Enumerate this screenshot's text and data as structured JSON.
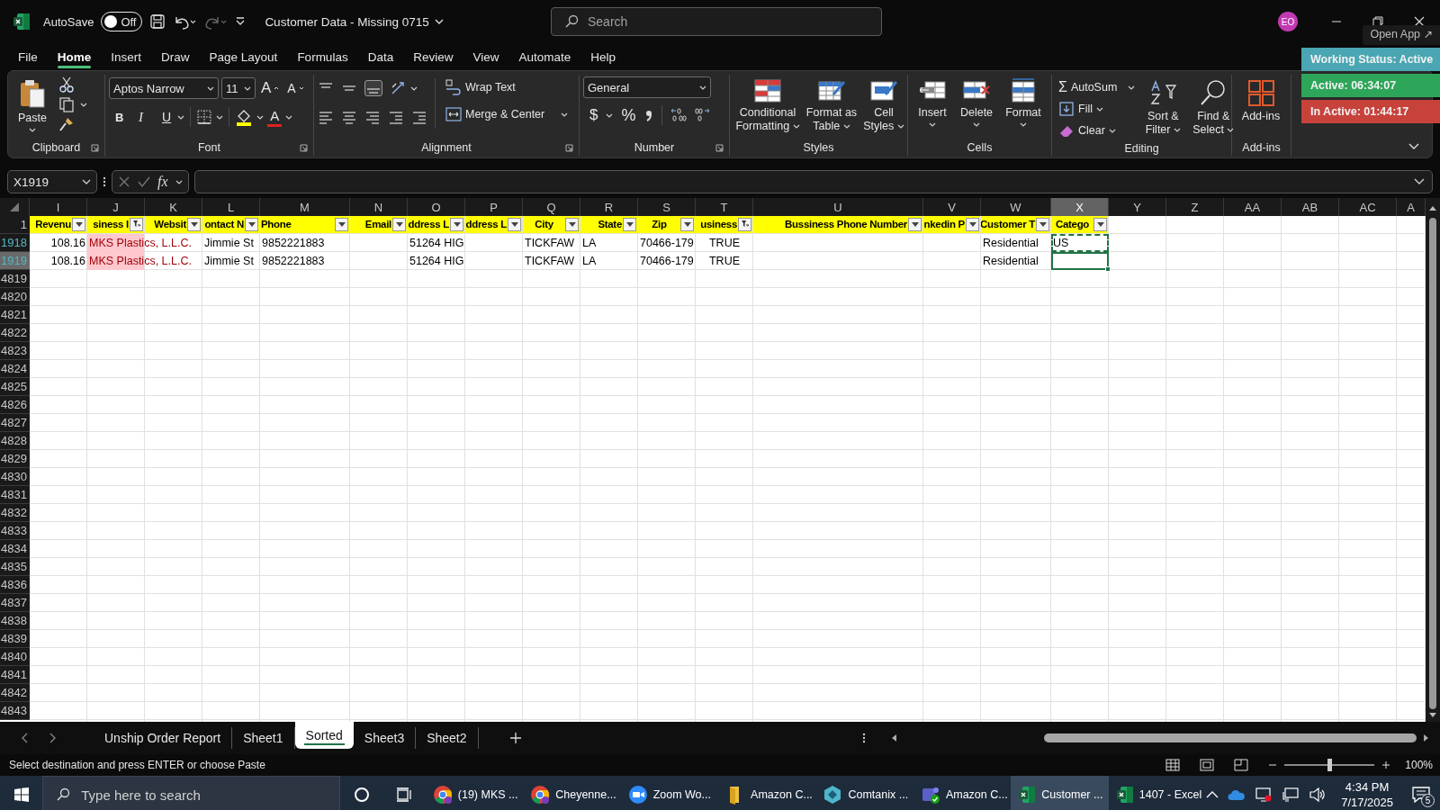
{
  "title_bar": {
    "autosave_label": "AutoSave",
    "autosave": {
      "on": false,
      "label": "Off"
    },
    "document_title": "Customer Data - Missing 0715",
    "search_placeholder": "Search",
    "avatar": "EO"
  },
  "menu_tabs": [
    {
      "label": "File",
      "selected": false
    },
    {
      "label": "Home",
      "selected": true
    },
    {
      "label": "Insert",
      "selected": false
    },
    {
      "label": "Draw",
      "selected": false
    },
    {
      "label": "Page Layout",
      "selected": false
    },
    {
      "label": "Formulas",
      "selected": false
    },
    {
      "label": "Data",
      "selected": false
    },
    {
      "label": "Review",
      "selected": false
    },
    {
      "label": "View",
      "selected": false
    },
    {
      "label": "Automate",
      "selected": false
    },
    {
      "label": "Help",
      "selected": false
    }
  ],
  "ribbon": {
    "clipboard": {
      "paste": "Paste",
      "label": "Clipboard"
    },
    "font": {
      "font_name": "Aptos Narrow",
      "font_size": "11",
      "grow": "A",
      "shrink": "A",
      "bold": "B",
      "italic": "I",
      "underline": "U",
      "font_color": "A",
      "label": "Font"
    },
    "alignment": {
      "wrap_text": "Wrap Text",
      "merge_center": "Merge & Center",
      "label": "Alignment"
    },
    "number": {
      "format": "General",
      "currency": "$",
      "percent": "%",
      "label": "Number"
    },
    "styles": {
      "buttons": [
        "Conditional Formatting",
        "Format as Table",
        "Cell Styles"
      ],
      "label": "Styles"
    },
    "cells": {
      "buttons": [
        "Insert",
        "Delete",
        "Format"
      ],
      "label": "Cells"
    },
    "editing": {
      "autosum_symbol": "Σ",
      "autosum": "AutoSum",
      "fill": "Fill",
      "clear": "Clear",
      "sort_filter": "Sort & Filter",
      "find_select": "Find & Select",
      "label": "Editing"
    },
    "addins": {
      "button": "Add-ins",
      "label": "Add-ins"
    }
  },
  "tracker": {
    "open_app": "Open App ↗",
    "statuses": [
      {
        "text": "Working Status: Active",
        "color": "#4aa6b2"
      },
      {
        "text": "Active: 06:34:07",
        "color": "#2ea65a"
      },
      {
        "text": "In Active: 01:44:17",
        "color": "#c8423c"
      }
    ]
  },
  "formula_bar": {
    "name_box": "X1919",
    "function_label": "fx"
  },
  "sheet": {
    "columns": [
      {
        "letter": "I",
        "header": "Revenu",
        "filtered": false,
        "selected": false,
        "duplicate_highlight": false
      },
      {
        "letter": "J",
        "header": "siness I",
        "filtered": true,
        "selected": false,
        "duplicate_highlight": true
      },
      {
        "letter": "K",
        "header": "Websit",
        "filtered": false,
        "selected": false,
        "duplicate_highlight": false
      },
      {
        "letter": "L",
        "header": "ontact N",
        "filtered": false,
        "selected": false,
        "duplicate_highlight": false
      },
      {
        "letter": "M",
        "header": "Phone",
        "filtered": false,
        "selected": false,
        "duplicate_highlight": false
      },
      {
        "letter": "N",
        "header": "Email",
        "filtered": false,
        "selected": false,
        "duplicate_highlight": false
      },
      {
        "letter": "O",
        "header": "ddress L",
        "filtered": false,
        "selected": false,
        "duplicate_highlight": false
      },
      {
        "letter": "P",
        "header": "ddress L",
        "filtered": false,
        "selected": false,
        "duplicate_highlight": false
      },
      {
        "letter": "Q",
        "header": "City",
        "filtered": false,
        "selected": false,
        "duplicate_highlight": false
      },
      {
        "letter": "R",
        "header": "State",
        "filtered": false,
        "selected": false,
        "duplicate_highlight": false
      },
      {
        "letter": "S",
        "header": "Zip",
        "filtered": false,
        "selected": false,
        "duplicate_highlight": false
      },
      {
        "letter": "T",
        "header": "usiness",
        "filtered": true,
        "selected": false,
        "duplicate_highlight": false
      },
      {
        "letter": "U",
        "header": "Bussiness Phone Number",
        "filtered": false,
        "selected": false,
        "duplicate_highlight": false
      },
      {
        "letter": "V",
        "header": "nkedin P",
        "filtered": false,
        "selected": false,
        "duplicate_highlight": false
      },
      {
        "letter": "W",
        "header": "Customer T",
        "filtered": false,
        "selected": false,
        "duplicate_highlight": false
      },
      {
        "letter": "X",
        "header": "Catego",
        "filtered": false,
        "selected": true,
        "duplicate_highlight": false
      }
    ],
    "extra_columns": [
      "Y",
      "Z",
      "AA",
      "AB",
      "AC",
      "A"
    ],
    "header_row": "1",
    "rows": [
      {
        "number": "1918",
        "filtered": true,
        "selected": false,
        "copied": true,
        "cells": [
          "108.16",
          "MKS Plastics, L.L.C.",
          null,
          "Jimmie St",
          "9852221883",
          null,
          "51264 HIG",
          null,
          "TICKFAW",
          "LA",
          "70466-179",
          "TRUE",
          null,
          null,
          "Residential",
          "US"
        ]
      },
      {
        "number": "1919",
        "filtered": true,
        "selected": true,
        "copied": false,
        "cells": [
          "108.16",
          "MKS Plastics, L.L.C.",
          null,
          "Jimmie St",
          "9852221883",
          null,
          "51264 HIG",
          null,
          "TICKFAW",
          "LA",
          "70466-179",
          "TRUE",
          null,
          null,
          "Residential",
          null
        ]
      }
    ],
    "blank_rows": [
      "4819",
      "4820",
      "4821",
      "4822",
      "4823",
      "4824",
      "4825",
      "4826",
      "4827",
      "4828",
      "4829",
      "4830",
      "4831",
      "4832",
      "4833",
      "4834",
      "4835",
      "4836",
      "4837",
      "4838",
      "4839",
      "4840",
      "4841",
      "4842",
      "4843"
    ]
  },
  "sheet_tabs": [
    {
      "label": "Unship Order Report",
      "selected": false
    },
    {
      "label": "Sheet1",
      "selected": false
    },
    {
      "label": "Sorted",
      "selected": true
    },
    {
      "label": "Sheet3",
      "selected": false
    },
    {
      "label": "Sheet2",
      "selected": false
    }
  ],
  "status_bar": {
    "message": "Select destination and press ENTER or choose Paste",
    "zoom": {
      "level": 0.5,
      "label": "100%"
    }
  },
  "taskbar": {
    "search_placeholder": "Type here to search",
    "apps": [
      {
        "kind": "chrome",
        "label": "(19) MKS ...",
        "selected": false
      },
      {
        "kind": "chrome",
        "label": "Cheyenne...",
        "selected": false
      },
      {
        "kind": "zoom",
        "label": "Zoom Wo...",
        "selected": false
      },
      {
        "kind": "folder",
        "label": "Amazon C...",
        "selected": false
      },
      {
        "kind": "comtanix",
        "label": "Comtanix ...",
        "selected": false
      },
      {
        "kind": "teams",
        "label": "Amazon C...",
        "selected": false
      },
      {
        "kind": "excel",
        "label": "Customer ...",
        "selected": true
      },
      {
        "kind": "excel",
        "label": "1407 - Excel",
        "selected": false
      }
    ],
    "time": "4:34 PM",
    "date": "7/17/2025",
    "notifications": "5"
  }
}
